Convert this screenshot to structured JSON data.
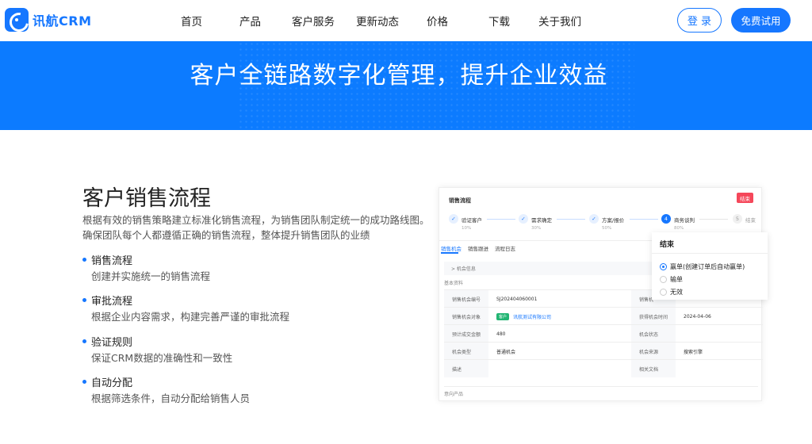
{
  "header": {
    "logo_text": "讯航CRM",
    "nav": [
      "首页",
      "产品",
      "客户服务",
      "更新动态",
      "价格",
      "下载",
      "关于我们"
    ],
    "login_label": "登 录",
    "trial_label": "免费试用"
  },
  "banner": {
    "title": "客户全链路数字化管理，提升企业效益"
  },
  "section": {
    "title": "客户销售流程",
    "description": "根据有效的销售策略建立标准化销售流程，为销售团队制定统一的成功路线图。确保团队每个人都遵循正确的销售流程，整体提升销售团队的业绩",
    "features": [
      {
        "title": "销售流程",
        "desc": "创建并实施统一的销售流程"
      },
      {
        "title": "审批流程",
        "desc": "根据企业内容需求，构建完善严谨的审批流程"
      },
      {
        "title": "验证规则",
        "desc": "保证CRM数据的准确性和一致性"
      },
      {
        "title": "自动分配",
        "desc": "根据筛选条件，自动分配给销售人员"
      }
    ]
  },
  "mockup": {
    "title": "销售流程",
    "corner_button": "结束",
    "steps": [
      {
        "label": "验证客户",
        "pct": "10%",
        "icon": "✓"
      },
      {
        "label": "需求确定",
        "pct": "30%",
        "icon": "✓"
      },
      {
        "label": "方案/报价",
        "pct": "50%",
        "icon": "✓"
      },
      {
        "label": "商务谈判",
        "pct": "80%",
        "icon": "4"
      },
      {
        "label": "结束",
        "pct": "",
        "icon": "5"
      }
    ],
    "tabs": [
      "销售机会",
      "销售跟进",
      "流程日志"
    ],
    "subheader": "> 机会信息",
    "section_label": "基本资料",
    "rows": [
      {
        "l1": "销售机会编号",
        "v1": "SJ202404060001",
        "l2": "销售机",
        "v2": ""
      },
      {
        "l1": "销售机会对象",
        "tag": "客户",
        "v1": "讯航测试有限公司",
        "l2": "获得机会时间",
        "v2": "2024-04-06"
      },
      {
        "l1": "预计成交金额",
        "v1": "480",
        "l2": "机会状态",
        "v2": ""
      },
      {
        "l1": "机会类型",
        "v1": "普通机会",
        "l2": "机会来源",
        "v2": "搜索引擎"
      },
      {
        "l1": "描述",
        "v1": "",
        "l2": "相关文档",
        "v2": ""
      }
    ],
    "footer_label": "意向产品",
    "popup": {
      "title": "结束",
      "options": [
        "赢单(创建订单后自动赢单)",
        "输单",
        "无效"
      ],
      "selected": 0
    }
  },
  "colors": {
    "primary": "#1677ff",
    "banner": "#0c7bff",
    "danger": "#f5475a",
    "tag_green": "#22b573"
  }
}
